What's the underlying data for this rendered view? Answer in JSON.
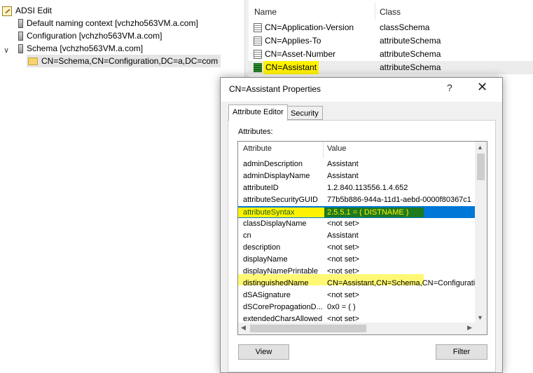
{
  "tree": {
    "root_label": "ADSI Edit",
    "items": [
      {
        "label": "Default naming context [vchzho563VM.a.com]"
      },
      {
        "label": "Configuration [vchzho563VM.a.com]"
      },
      {
        "label": "Schema [vchzho563VM.a.com]"
      },
      {
        "label": "CN=Schema,CN=Configuration,DC=a,DC=com"
      }
    ]
  },
  "list": {
    "columns": [
      "Name",
      "Class"
    ],
    "rows": [
      {
        "name": "CN=Application-Version",
        "class": "classSchema"
      },
      {
        "name": "CN=Applies-To",
        "class": "attributeSchema"
      },
      {
        "name": "CN=Asset-Number",
        "class": "attributeSchema"
      },
      {
        "name": "CN=Assistant",
        "class": "attributeSchema"
      }
    ],
    "selected_index": 3
  },
  "dialog": {
    "title": "CN=Assistant Properties",
    "help": "?",
    "close": "✕",
    "tabs": [
      "Attribute Editor",
      "Security"
    ],
    "active_tab": 0,
    "attributes_label": "Attributes:",
    "columns": [
      "Attribute",
      "Value"
    ],
    "rows": [
      {
        "attr": "adminDescription",
        "value": "Assistant"
      },
      {
        "attr": "adminDisplayName",
        "value": "Assistant"
      },
      {
        "attr": "attributeID",
        "value": "1.2.840.113556.1.4.652"
      },
      {
        "attr": "attributeSecurityGUID",
        "value": "77b5b886-944a-11d1-aebd-0000f80367c1"
      },
      {
        "attr": "attributeSyntax",
        "value": "2.5.5.1 = ( DISTNAME )"
      },
      {
        "attr": "classDisplayName",
        "value": "<not set>"
      },
      {
        "attr": "cn",
        "value": "Assistant"
      },
      {
        "attr": "description",
        "value": "<not set>"
      },
      {
        "attr": "displayName",
        "value": "<not set>"
      },
      {
        "attr": "displayNamePrintable",
        "value": "<not set>"
      },
      {
        "attr": "distinguishedName",
        "value": "CN=Assistant,CN=Schema,CN=Configuration"
      },
      {
        "attr": "dSASignature",
        "value": "<not set>"
      },
      {
        "attr": "dSCorePropagationD...",
        "value": "0x0 = ( )"
      },
      {
        "attr": "extendedCharsAllowed",
        "value": "<not set>"
      }
    ],
    "selected_row": 4,
    "view_button": "View",
    "filter_button": "Filter"
  },
  "colors": {
    "selection": "#0078d7",
    "highlight_yellow": "#fff200",
    "highlight_green": "#1e7a1e"
  }
}
